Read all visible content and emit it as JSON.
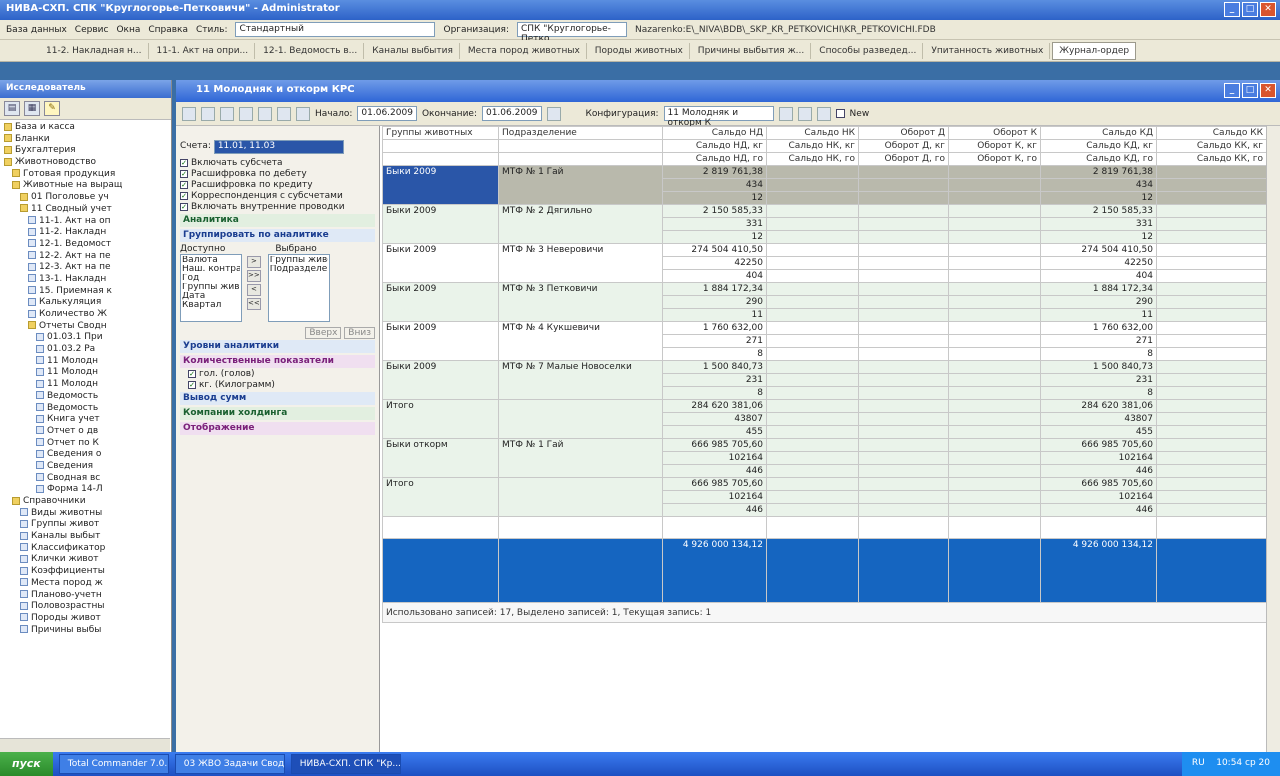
{
  "window": {
    "title": "НИВА-СХП. СПК \"Круглогорье-Петковичи\" - Administrator"
  },
  "menu": {
    "items": [
      "База данных",
      "Сервис",
      "Окна",
      "Справка"
    ],
    "style_label": "Стиль:",
    "style_value": "Стандартный",
    "org_label": "Организация:",
    "org_value": "СПК \"Круглогорье-Петко",
    "path": "Nazarenko:E\\_NIVA\\BDB\\_SKP_KR_PETKOVICHI\\KR_PETKOVICHI.FDB"
  },
  "tabs": [
    "11-2. Накладная н...",
    "11-1. Акт на опри...",
    "12-1. Ведомость в...",
    "Каналы выбытия",
    "Места пород животных",
    "Породы животных",
    "Причины выбытия ж...",
    "Способы разведед...",
    "Упитанность животных",
    "Журнал-ордер"
  ],
  "left_panel": {
    "title": "Исследователь",
    "tree": [
      "База и касса",
      "Бланки",
      "Бухгалтерия",
      "Животноводство",
      "Готовая продукция",
      "Животные на выращ",
      "01 Поголовье уч",
      "11 Сводный учет",
      "11-1. Акт на оп",
      "11-2. Накладн",
      "12-1. Ведомост",
      "12-2. Акт на пе",
      "12-3. Акт на пе",
      "13-1. Накладн",
      "15. Приемная к",
      "Калькуляция",
      "Количество Ж",
      "Отчеты Сводн",
      "01.03.1 При",
      "01.03.2 Ра",
      "11 Молодн",
      "11 Молодн",
      "11 Молодн",
      "Ведомость",
      "Ведомость",
      "Книга учет",
      "Отчет о дв",
      "Отчет по К",
      "Сведения о",
      "Сведения",
      "Сводная вс",
      "Форма 14-Л",
      "Справочники",
      "Виды животны",
      "Группы живот",
      "Каналы выбыт",
      "Классификатор",
      "Клички живот",
      "Коэффициенты",
      "Места пород ж",
      "Планово-учетн",
      "Половозрастны",
      "Породы живот",
      "Причины выбы"
    ]
  },
  "main": {
    "title": "11 Молодняк и откорм КРС",
    "period_start_label": "Начало:",
    "period_start": "01.06.2009",
    "period_end_label": "Окончание:",
    "period_end": "01.06.2009",
    "config_label": "Конфигурация:",
    "config_value": "11 Молодняк и откорм К",
    "new_label": "New"
  },
  "filter": {
    "accounts_label": "Счета:",
    "accounts_value": "11.01, 11.03",
    "checks": [
      "Включать субсчета",
      "Расшифровка по дебету",
      "Расшифровка по кредиту",
      "Корреспонденция с субсчетами",
      "Включать внутренние проводки"
    ],
    "sec_analytics": "Аналитика",
    "sec_group": "Группировать по аналитике",
    "available_label": "Доступно",
    "chosen_label": "Выбрано",
    "available": [
      "Валюта",
      "Наш. контраг",
      "Год",
      "Группы живо",
      "Дата",
      "Квартал"
    ],
    "chosen": [
      "Группы живо",
      "Подразделен"
    ],
    "apply_btns": [
      "Вверх",
      "Вниз"
    ],
    "sec_level": "Уровни аналитики",
    "sec_quant": "Количественные показатели",
    "quant_checks": [
      "гол. (голов)",
      "кг. (Килограмм)"
    ],
    "sec_output": "Вывод сумм",
    "sec_company": "Компании холдинга",
    "sec_display": "Отображение"
  },
  "grid": {
    "headers1": [
      "Группы животных",
      "Подразделение",
      "Сальдо НД",
      "Сальдо НК",
      "Оборот Д",
      "Оборот К",
      "Сальдо КД",
      "Сальдо КК"
    ],
    "headers2": [
      "",
      "",
      "Сальдо НД, кг",
      "Сальдо НК, кг",
      "Оборот Д, кг",
      "Оборот К, кг",
      "Сальдо КД, кг",
      "Сальдо КК, кг"
    ],
    "headers3": [
      "",
      "",
      "Сальдо НД, го",
      "Сальдо НК, го",
      "Оборот Д, го",
      "Оборот К, го",
      "Сальдо КД, го",
      "Сальдо КК, го"
    ],
    "groups": [
      {
        "group": "Быки 2009",
        "div": "МТФ № 1 Гай",
        "nd": [
          "2 819 761,38",
          "434",
          "12"
        ],
        "kd": [
          "2 819 761,38",
          "434",
          "12"
        ]
      },
      {
        "group": "Быки 2009",
        "div": "МТФ № 2 Дягильно",
        "nd": [
          "2 150 585,33",
          "331",
          "12"
        ],
        "kd": [
          "2 150 585,33",
          "331",
          "12"
        ]
      },
      {
        "group": "Быки 2009",
        "div": "МТФ № 3 Неверовичи",
        "nd": [
          "274 504 410,50",
          "42250",
          "404"
        ],
        "kd": [
          "274 504 410,50",
          "42250",
          "404"
        ]
      },
      {
        "group": "Быки 2009",
        "div": "МТФ № 3 Петковичи",
        "nd": [
          "1 884 172,34",
          "290",
          "11"
        ],
        "kd": [
          "1 884 172,34",
          "290",
          "11"
        ]
      },
      {
        "group": "Быки 2009",
        "div": "МТФ № 4 Кукшевичи",
        "nd": [
          "1 760 632,00",
          "271",
          "8"
        ],
        "kd": [
          "1 760 632,00",
          "271",
          "8"
        ]
      },
      {
        "group": "Быки 2009",
        "div": "МТФ № 7 Малые Новоселки",
        "nd": [
          "1 500 840,73",
          "231",
          "8"
        ],
        "kd": [
          "1 500 840,73",
          "231",
          "8"
        ]
      },
      {
        "group": "Итого",
        "div": "",
        "nd": [
          "284 620 381,06",
          "43807",
          "455"
        ],
        "kd": [
          "284 620 381,06",
          "43807",
          "455"
        ]
      },
      {
        "group": "Быки откорм",
        "div": "МТФ № 1 Гай",
        "nd": [
          "666 985 705,60",
          "102164",
          "446"
        ],
        "kd": [
          "666 985 705,60",
          "102164",
          "446"
        ]
      },
      {
        "group": "Итого",
        "div": "",
        "nd": [
          "666 985 705,60",
          "102164",
          "446"
        ],
        "kd": [
          "666 985 705,60",
          "102164",
          "446"
        ]
      }
    ],
    "grand_total_nd": "4 926 000 134,12",
    "grand_total_kd": "4 926 000 134,12",
    "status": "Использовано записей: 17, Выделено записей: 1, Текущая запись: 1"
  },
  "taskbar": {
    "start": "пуск",
    "tasks": [
      "Total Commander 7.0...",
      "03 ЖВО Задачи Свод...",
      "НИВА-СХП. СПК \"Кр..."
    ],
    "lang": "RU",
    "clock": "10:54 ср 20"
  },
  "colors": {
    "selection": "#2a56a8",
    "total_row": "#1565c0",
    "row_alt": "#eaf3ea",
    "group_gray": "#b9b9ac"
  }
}
